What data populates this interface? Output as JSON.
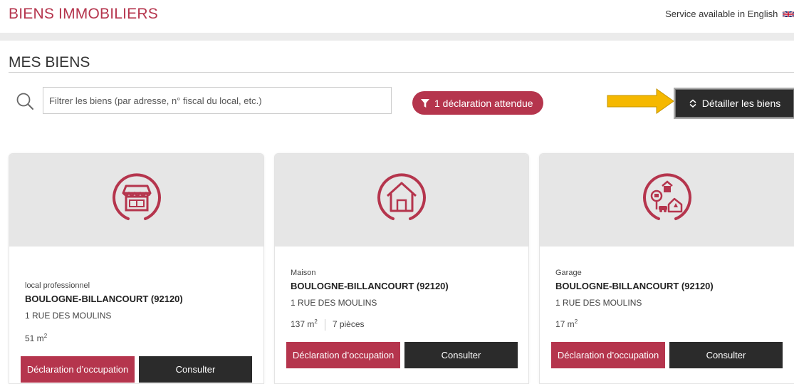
{
  "header": {
    "site_title": "BIENS IMMOBILIERS",
    "language_link": "Service available in English"
  },
  "section": {
    "title": "MES BIENS"
  },
  "filter": {
    "placeholder": "Filtrer les biens (par adresse, n° fiscal du local, etc.)",
    "pending_badge": "1 déclaration attendue",
    "detail_button": "Détailler les biens"
  },
  "colors": {
    "accent": "#b5354d",
    "dark_button": "#2b2b2b",
    "arrow": "#f5b800"
  },
  "properties": [
    {
      "icon": "shop-icon",
      "type": "local professionnel",
      "city": "BOULOGNE-BILLANCOURT (92120)",
      "street": "1 RUE DES MOULINS",
      "area": "51 m",
      "area_unit_exp": "2",
      "rooms": "",
      "declare_label": "Déclaration d’occupation",
      "consult_label": "Consulter"
    },
    {
      "icon": "house-icon",
      "type": "Maison",
      "city": "BOULOGNE-BILLANCOURT (92120)",
      "street": "1 RUE DES MOULINS",
      "area": "137 m",
      "area_unit_exp": "2",
      "rooms": "7 pièces",
      "declare_label": "Déclaration d’occupation",
      "consult_label": "Consulter"
    },
    {
      "icon": "garage-icon",
      "type": "Garage",
      "city": "BOULOGNE-BILLANCOURT (92120)",
      "street": "1 RUE DES MOULINS",
      "area": "17 m",
      "area_unit_exp": "2",
      "rooms": "",
      "declare_label": "Déclaration d’occupation",
      "consult_label": "Consulter"
    }
  ]
}
